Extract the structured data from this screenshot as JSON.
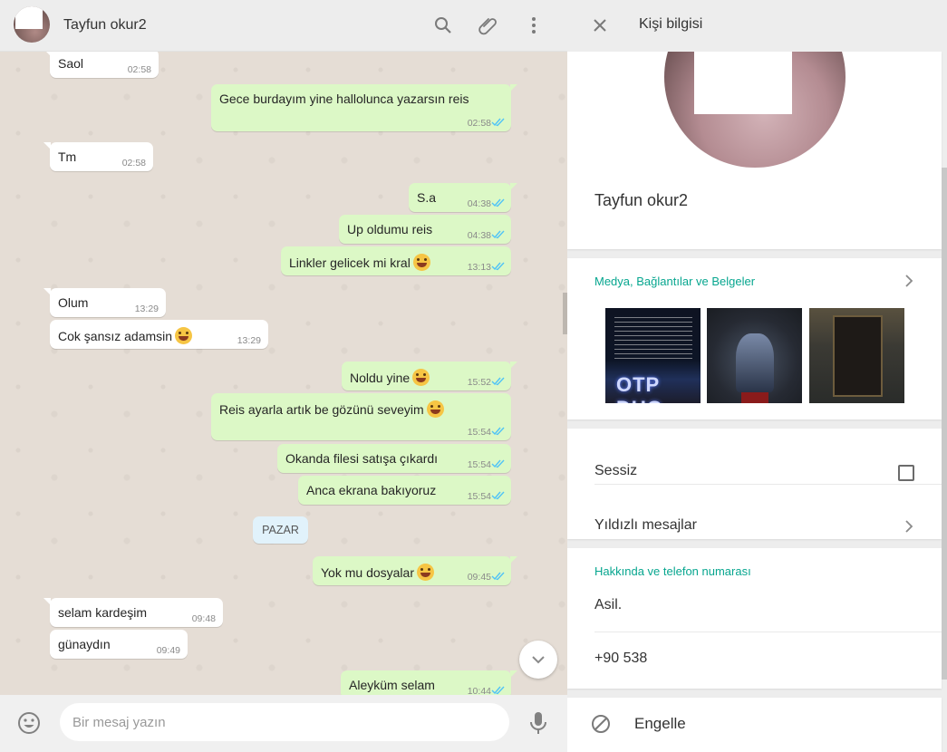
{
  "chat": {
    "contact_name": "Tayfun okur2",
    "icons": [
      "search-icon",
      "attach-icon",
      "menu-icon"
    ],
    "messages": [
      {
        "dir": "in",
        "text": "Saol",
        "time": "02:58"
      },
      {
        "dir": "out",
        "text": "Gece burdayım yine hallolunca yazarsın reis",
        "time": "02:58"
      },
      {
        "dir": "in",
        "text": "Tm",
        "time": "02:58"
      },
      {
        "dir": "out",
        "text": "S.a",
        "time": "04:38"
      },
      {
        "dir": "out",
        "text": "Up oldumu reis",
        "time": "04:38"
      },
      {
        "dir": "out",
        "text": "Linkler gelicek mi kral",
        "time": "13:13",
        "emoji": "grin-sweat"
      },
      {
        "dir": "in",
        "text": "Olum",
        "time": "13:29"
      },
      {
        "dir": "in",
        "text": "Cok şansız adamsin",
        "time": "13:29",
        "emoji": "grin-sweat"
      },
      {
        "dir": "out",
        "text": "Noldu yine",
        "time": "15:52",
        "emoji": "grin-sweat"
      },
      {
        "dir": "out",
        "text": "Reis ayarla artık be gözünü seveyim",
        "time": "15:54",
        "emoji": "grin-sweat"
      },
      {
        "dir": "out",
        "text": "Okanda filesi satışa çıkardı",
        "time": "15:54"
      },
      {
        "dir": "out",
        "text": "Anca ekrana bakıyoruz",
        "time": "15:54"
      },
      {
        "dir": "out",
        "text": "Yok mu dosyalar",
        "time": "09:45",
        "emoji": "smile"
      },
      {
        "dir": "in",
        "text": "selam kardeşim",
        "time": "09:48"
      },
      {
        "dir": "in",
        "text": "günaydın",
        "time": "09:49"
      },
      {
        "dir": "out",
        "text": "Aleyküm selam",
        "time": "10:44"
      }
    ],
    "date_chip": "PAZAR",
    "composer": {
      "placeholder": "Bir mesaj yazın"
    }
  },
  "info": {
    "title": "Kişi bilgisi",
    "name": "Tayfun okur2",
    "media_label": "Medya, Bağlantılar ve Belgeler",
    "media_thumb_text": "OTP DUO",
    "mute_label": "Sessiz",
    "starred_label": "Yıldızlı mesajlar",
    "about_label": "Hakkında ve telefon numarası",
    "about_text": "Asil.",
    "phone": "+90 538",
    "block_label": "Engelle"
  },
  "colors": {
    "accent": "#07a68f",
    "outgoing_bubble": "#dcf8c6",
    "chat_bg": "#e5ddd5",
    "read_tick": "#4fc3f7"
  }
}
